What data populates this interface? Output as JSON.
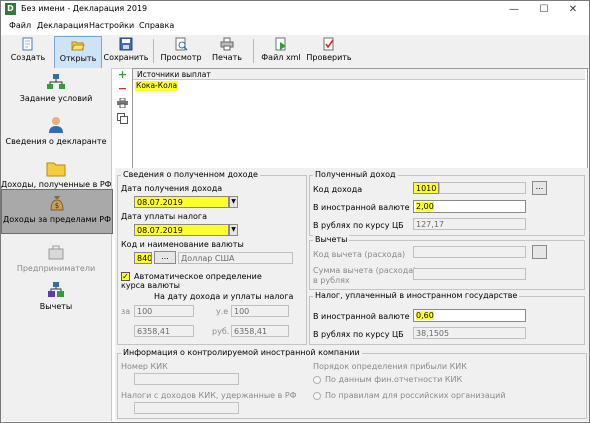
{
  "window": {
    "title": "Без имени - Декларация 2019",
    "app_icon": "D",
    "minimize": "—",
    "maximize": "☐",
    "close": "✕"
  },
  "menu": [
    "Файл",
    "Декларация",
    "Настройки",
    "Справка"
  ],
  "toolbar": {
    "create": "Создать",
    "open": "Открыть",
    "save": "Сохранить",
    "preview": "Просмотр",
    "print": "Печать",
    "xml": "Файл xml",
    "check": "Проверить"
  },
  "nav": [
    {
      "label": "Задание условий",
      "icon": "conditions-icon"
    },
    {
      "label": "Сведения о декларанте",
      "icon": "person-icon"
    },
    {
      "label": "Доходы, полученные в РФ",
      "icon": "folder-icon"
    },
    {
      "label": "Доходы за пределами РФ",
      "icon": "money-bag-icon"
    },
    {
      "label": "Предприниматели",
      "icon": "entrepreneur-icon"
    },
    {
      "label": "Вычеты",
      "icon": "deductions-icon"
    }
  ],
  "side_buttons": {
    "add": "+",
    "remove": "−"
  },
  "sources": {
    "header": "Источники выплат",
    "rows": [
      "Кока-Кола"
    ]
  },
  "income_info": {
    "title": "Сведения о полученном доходе",
    "receipt_date_label": "Дата получения дохода",
    "receipt_date": "08.07.2019",
    "tax_date_label": "Дата уплаты налога",
    "tax_date": "08.07.2019",
    "currency_label": "Код и наименование валюты",
    "currency_code": "840",
    "currency_btn": "...",
    "currency_name": "Доллар США",
    "auto_rate_checked": "✓",
    "auto_rate_label_1": "Автоматическое определение",
    "auto_rate_label_2": "курса валюты",
    "rate_date_label": "На дату дохода и уплаты налога",
    "za_label": "за",
    "za_value": "100",
    "ue_label": "у.е",
    "ue_value": "100",
    "rub1": "6358,41",
    "rub_label": "руб.",
    "rub2": "6358,41"
  },
  "received_income": {
    "title": "Полученный доход",
    "code_label": "Код дохода",
    "code": "1010",
    "code_btn": "...",
    "foreign_label": "В иностранной валюте",
    "foreign": "2,00",
    "rub_label": "В рублях по курсу ЦБ",
    "rub": "127,17"
  },
  "deductions": {
    "title": "Вычеты",
    "code_label": "Код вычета (расхода)",
    "sum_label_1": "Сумма вычета (расхода)",
    "sum_label_2": "в рублях"
  },
  "foreign_tax": {
    "title": "Налог, уплаченный в иностранном государстве",
    "foreign_label": "В иностранной валюте",
    "foreign": "0,60",
    "rub_label": "В рублях по курсу ЦБ",
    "rub": "38,1505"
  },
  "kik": {
    "title": "Информация о контролируемой иностранной компании",
    "number_label": "Номер КИК",
    "taxes_label": "Налоги с доходов КИК, удержанные в РФ",
    "profit_label": "Порядок определения прибыли КИК",
    "option1": "По данным фин.отчетности КИК",
    "option2": "По правилам для российских организаций"
  }
}
